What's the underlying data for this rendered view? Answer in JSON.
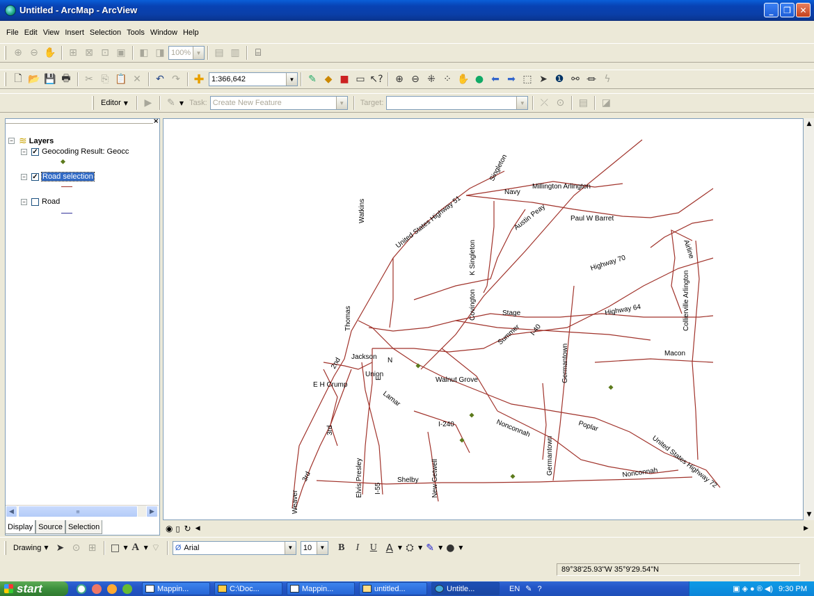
{
  "window": {
    "title": "Untitled - ArcMap - ArcView"
  },
  "menu": {
    "items": [
      "File",
      "Edit",
      "View",
      "Insert",
      "Selection",
      "Tools",
      "Window",
      "Help"
    ]
  },
  "toolbar": {
    "zoom_percent": "100%",
    "scale": "1:366,642"
  },
  "editor": {
    "label": "Editor",
    "task_label": "Task:",
    "task_value": "Create New Feature",
    "target_label": "Target:"
  },
  "toc": {
    "root": "Layers",
    "layers": [
      {
        "name": "Geocoding Result: Geocc",
        "checked": true,
        "selected": false
      },
      {
        "name": "Road selection",
        "checked": true,
        "selected": true
      },
      {
        "name": "Road",
        "checked": false,
        "selected": false
      }
    ],
    "tabs": [
      "Display",
      "Source",
      "Selection"
    ]
  },
  "map": {
    "road_color": "#a0322a",
    "point_color": "#5c7a1c",
    "labels": [
      "Millington Arlington",
      "Navy",
      "United States Highway 51",
      "Singleton",
      "Paul W Barret",
      "Austin Peay",
      "Watkins",
      "Airline",
      "K Singleton",
      "Highway 70",
      "Collierville Arlington",
      "Covington",
      "Stage",
      "Highway 64",
      "Thomas",
      "Summer",
      "I-40",
      "Germantown",
      "Jackson",
      "N",
      "Macon",
      "2nd",
      "Union",
      "E H Crump",
      "E",
      "Walnut Grove",
      "Lamar",
      "I-240",
      "Nonconnah",
      "Poplar",
      "3rd",
      "Germantown",
      "United States Highway 72",
      "Nonconnah",
      "Elvis Presley",
      "New Getwell",
      "Shelby",
      "3rd",
      "Weaver",
      "I-55"
    ]
  },
  "drawing": {
    "label": "Drawing",
    "font": "Arial",
    "size": "10"
  },
  "status": {
    "coords": "89°38'25.93\"W  35°9'29.54\"N"
  },
  "taskbar": {
    "start": "start",
    "tasks": [
      "Mappin...",
      "C:\\Doc...",
      "Mappin...",
      "untitled...",
      "Untitle..."
    ],
    "lang": "EN",
    "time": "9:30 PM"
  }
}
